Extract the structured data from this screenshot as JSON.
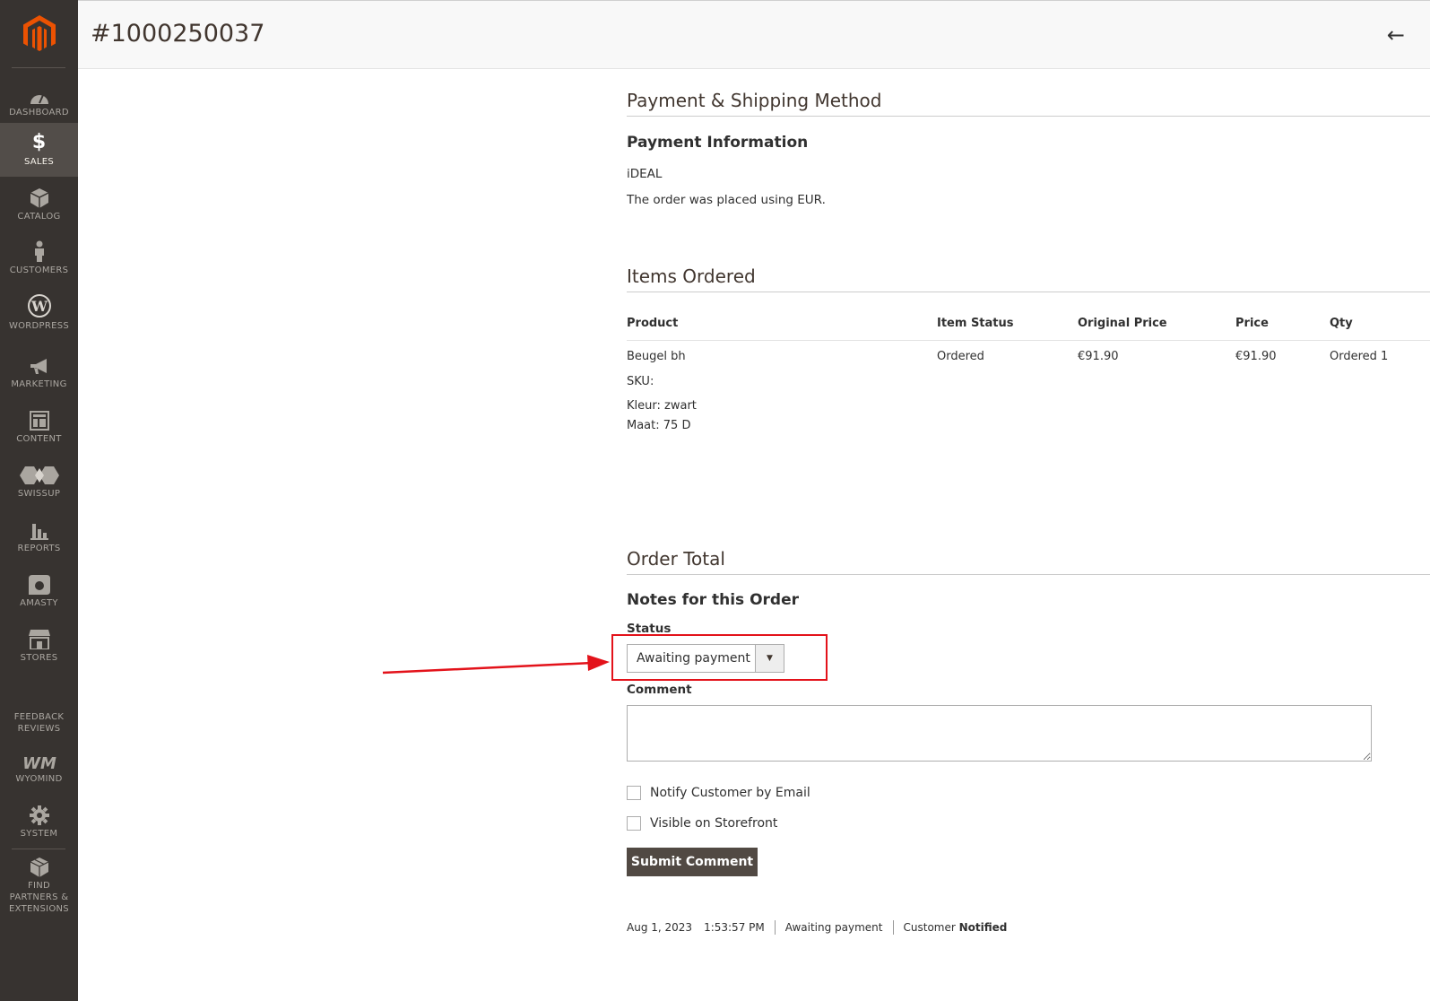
{
  "sidebar": {
    "items": [
      {
        "label": "DASHBOARD",
        "icon": "dashboard-icon"
      },
      {
        "label": "SALES",
        "icon": "dollar-icon"
      },
      {
        "label": "CATALOG",
        "icon": "box-icon"
      },
      {
        "label": "CUSTOMERS",
        "icon": "person-icon"
      },
      {
        "label": "WORDPRESS",
        "icon": "wordpress-icon"
      },
      {
        "label": "MARKETING",
        "icon": "megaphone-icon"
      },
      {
        "label": "CONTENT",
        "icon": "layout-icon"
      },
      {
        "label": "SWISSUP",
        "icon": "swissup-icon"
      },
      {
        "label": "REPORTS",
        "icon": "bar-chart-icon"
      },
      {
        "label": "AMASTY",
        "icon": "amasty-icon"
      },
      {
        "label": "STORES",
        "icon": "store-icon"
      },
      {
        "label": "FEEDBACK REVIEWS",
        "icon": ""
      },
      {
        "label": "WYOMIND",
        "icon": "wyomind-icon"
      },
      {
        "label": "SYSTEM",
        "icon": "gear-icon"
      },
      {
        "label": "FIND PARTNERS & EXTENSIONS",
        "icon": "cubes-icon"
      }
    ],
    "active": "SALES"
  },
  "header": {
    "title": "#1000250037",
    "back_icon": "←"
  },
  "payment": {
    "section_title": "Payment & Shipping Method",
    "info_title": "Payment Information",
    "method": "iDEAL",
    "currency_note": "The order was placed using EUR."
  },
  "items": {
    "section_title": "Items Ordered",
    "columns": [
      "Product",
      "Item Status",
      "Original Price",
      "Price",
      "Qty"
    ],
    "rows": [
      {
        "product": "Beugel bh",
        "sku": "SKU:",
        "kleur_label": "Kleur:",
        "kleur_value": "zwart",
        "maat_label": "Maat:",
        "maat_value": "75 D",
        "status": "Ordered",
        "original_price": "€91.90",
        "price": "€91.90",
        "qty": "Ordered 1"
      }
    ]
  },
  "order_total": {
    "section_title": "Order Total",
    "notes_title": "Notes for this Order",
    "status_label": "Status",
    "status_value": "Awaiting payment",
    "comment_label": "Comment",
    "notify_label": "Notify Customer by Email",
    "visible_label": "Visible on Storefront",
    "submit_label": "Submit Comment"
  },
  "history": {
    "date": "Aug 1, 2023",
    "time": "1:53:57 PM",
    "status": "Awaiting payment",
    "customer_label": "Customer",
    "customer_state": "Notified"
  },
  "colors": {
    "sidebar_bg": "#373330",
    "accent": "#eb5202",
    "highlight": "#e3121a",
    "button_bg": "#514943"
  }
}
